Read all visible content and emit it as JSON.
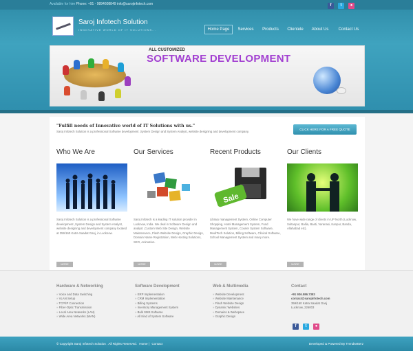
{
  "topbar": {
    "available_label": "Available for hire",
    "contact": "Phone: +91 - 9894608849 info@sarojinfotech.com"
  },
  "social": [
    "facebook-icon",
    "twitter-icon",
    "flickr-icon"
  ],
  "logo": {
    "title": "Saroj Infotech Solution",
    "tagline": "INNOVATIVE WORLD OF IT SOLUTIONS..."
  },
  "nav": {
    "items": [
      "Home Page",
      "Services",
      "Products",
      "Clientele",
      "About Us",
      "Contact Us"
    ],
    "active": "Home Page"
  },
  "banner": {
    "kicker": "ALL CUSTOMIZED",
    "headline": "SOFTWARE DEVELOPMENT"
  },
  "intro": {
    "title": "\"Fulfill needs of Innovative world of IT Solutions with us.\"",
    "text": "Saroj Infotech Solution is a professional Software development ,System Design and System Analyst, website designing and development company.",
    "button": "CLICK HERE FOR A FREE QUOTE"
  },
  "columns": [
    {
      "heading": "Who We Are",
      "text": "Saroj Infotech Solution is a professional Software development ,System Design and System Analyst, website designing and development company located at 359/160 Katra Saadat Ganj, in Lucknow.",
      "more": "MORE"
    },
    {
      "heading": "Our Services",
      "text": "Saroj Infotech is a leading IT solution provider in Lucknow, India. We deal in Software Design and analyst ,Custom Web Site Design, Website Maintenance, Flash Website Design, Graphic Design, Domain Name Registration, Web Hosting Solutions, SEO, Animation.",
      "more": "MORE"
    },
    {
      "heading": "Recent Products",
      "text": "Library management System, Online Computer Shopping, Hotel Management System, Fund Management System, Courier System Software, MediTech Solution, Billing Software, Clinical Software, School Management System and many more.",
      "more": "MORE"
    },
    {
      "heading": "Our Clients",
      "text": "We have wide range of clients in UP North (Lucknow, Sultanpur, Ballia, Basti, Varanasi, Kanpur, Banda, Allahabad etc).",
      "more": "MORE"
    }
  ],
  "footer": {
    "hardware": {
      "title": "Hardware & Networking",
      "items": [
        "Voice and Data Switching",
        "VLAN Setup",
        "TCP/IP Connection",
        "Fiber-Optic Transmission",
        "Local Area Networks (LAN)",
        "Wide Area Networks (WAN)"
      ]
    },
    "software": {
      "title": "Software Development",
      "items": [
        "ERP Implementation",
        "CRM Implementation",
        "Billing Systems",
        "Inventory Management System",
        "Bulk SMS Software",
        "All Kind of System Software"
      ]
    },
    "web": {
      "title": "Web & Multimedia",
      "items": [
        "Website Development",
        "Website Maintenance",
        "Flash Website Design",
        "Dynamic Websites",
        "Domains & Webspace",
        "Graphic Design"
      ]
    },
    "contact": {
      "title": "Contact",
      "phone": "+91 936.586.7383",
      "email": "contact@sarojinfotech.com",
      "address1": "359/160 Katra Saadat Ganj",
      "address2": "Lucknow, 226003"
    }
  },
  "bottom": {
    "copyright": "© Copyright Saroj Infotech Solution . All Rights Reserved.",
    "link_home": "Home",
    "sep": "|",
    "link_contact": "Contact",
    "developed_by": "Developed & Powered By Trendsetterz"
  },
  "colors": {
    "header": "#3fa3bf",
    "banner_headline": "#a23fd1",
    "button": "#2f90ae"
  }
}
